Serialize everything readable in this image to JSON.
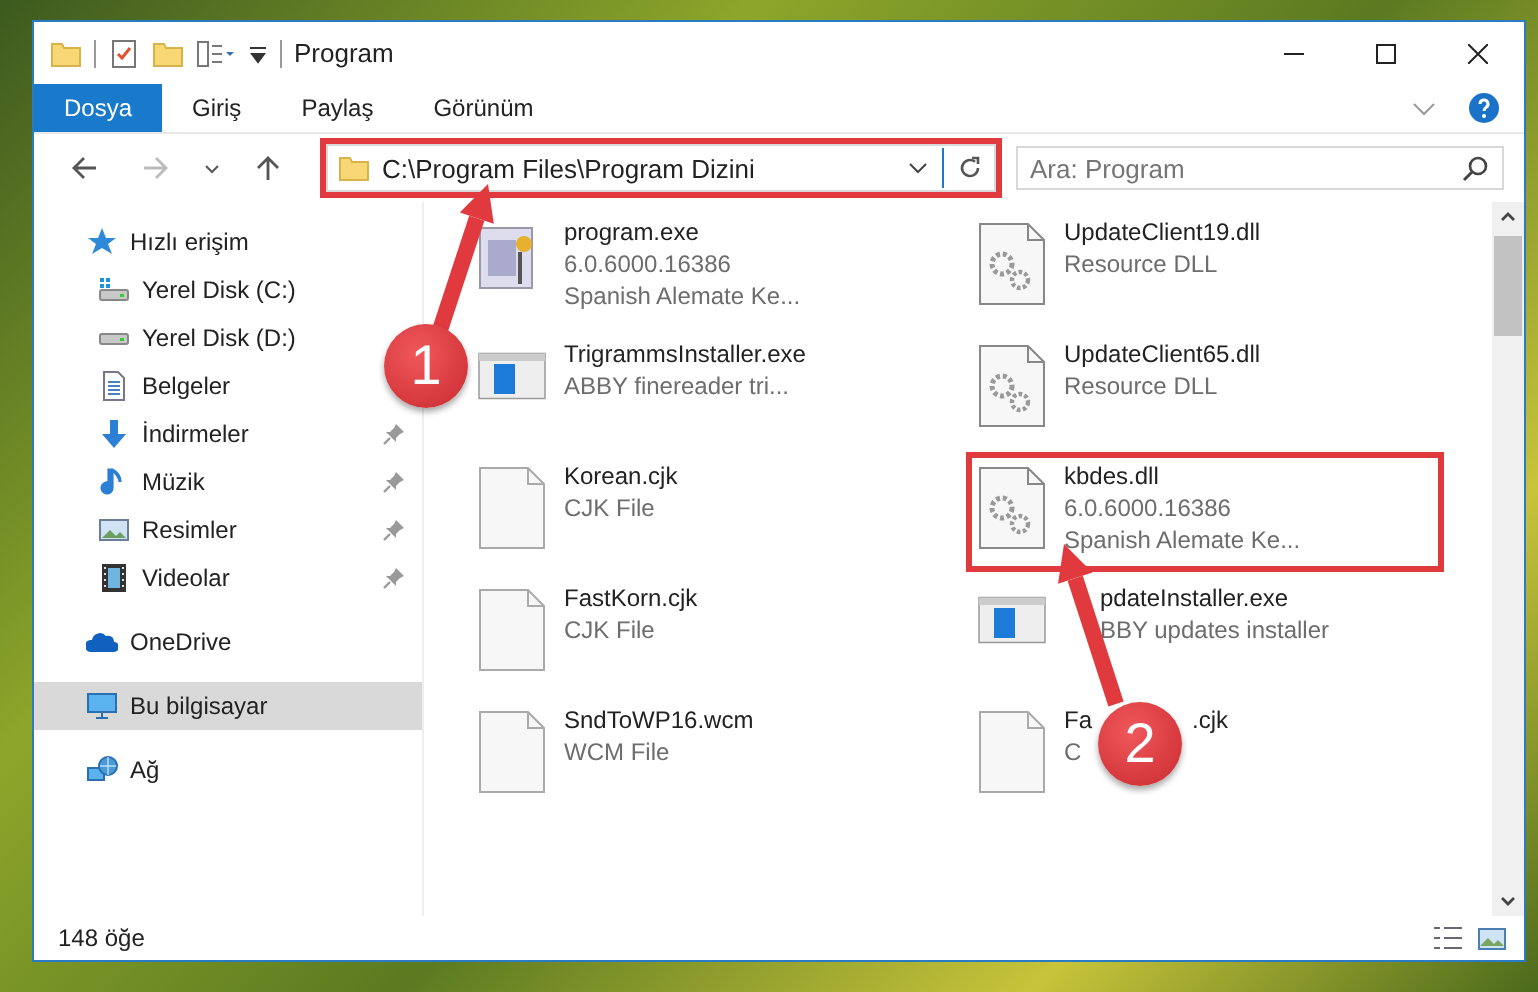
{
  "window": {
    "title": "Program"
  },
  "ribbon_tabs": [
    {
      "label": "Dosya",
      "selected": true
    },
    {
      "label": "Giriş",
      "selected": false
    },
    {
      "label": "Paylaş",
      "selected": false
    },
    {
      "label": "Görünüm",
      "selected": false
    }
  ],
  "address_bar": {
    "path": "C:\\Program Files\\Program Dizini",
    "highlighted": true
  },
  "search": {
    "placeholder": "Ara: Program"
  },
  "sidebar": {
    "items": [
      {
        "label": "Hızlı erişim",
        "kind": "star",
        "selected": false,
        "children": [
          {
            "label": "Yerel Disk (C:)",
            "kind": "system-drive",
            "pinned": false,
            "selected": false
          },
          {
            "label": "Yerel Disk (D:)",
            "kind": "drive",
            "pinned": false,
            "selected": false
          },
          {
            "label": "Belgeler",
            "kind": "documents",
            "pinned": false,
            "selected": false
          },
          {
            "label": "İndirmeler",
            "kind": "downloads",
            "pinned": true,
            "selected": false
          },
          {
            "label": "Müzik",
            "kind": "music",
            "pinned": true,
            "selected": false
          },
          {
            "label": "Resimler",
            "kind": "pictures",
            "pinned": true,
            "selected": false
          },
          {
            "label": "Videolar",
            "kind": "videos",
            "pinned": true,
            "selected": false
          }
        ]
      },
      {
        "label": "OneDrive",
        "kind": "cloud",
        "selected": false
      },
      {
        "label": "Bu bilgisayar",
        "kind": "computer",
        "selected": true
      },
      {
        "label": "Ağ",
        "kind": "network",
        "selected": false
      }
    ]
  },
  "files": [
    {
      "name": "program.exe",
      "details": [
        "6.0.6000.16386",
        "Spanish Alemate Ke..."
      ],
      "kind": "app",
      "highlighted": false
    },
    {
      "name": "UpdateClient19.dll",
      "details": [
        "Resource DLL"
      ],
      "kind": "dll",
      "highlighted": false
    },
    {
      "name": "TrigrammsInstaller.exe",
      "details": [
        "ABBY finereader tri..."
      ],
      "kind": "installer",
      "highlighted": false
    },
    {
      "name": "UpdateClient65.dll",
      "details": [
        "Resource DLL"
      ],
      "kind": "dll",
      "highlighted": false
    },
    {
      "name": "Korean.cjk",
      "details": [
        "CJK File"
      ],
      "kind": "blank",
      "highlighted": false
    },
    {
      "name": "kbdes.dll",
      "details": [
        "6.0.6000.16386",
        "Spanish Alemate Ke..."
      ],
      "kind": "dll",
      "highlighted": true
    },
    {
      "name": "FastKorn.cjk",
      "details": [
        "CJK File"
      ],
      "kind": "blank",
      "highlighted": false
    },
    {
      "name": "pdateInstaller.exe",
      "details": [
        "BBY updates installer"
      ],
      "kind": "installer",
      "highlighted": false,
      "covered_start": true
    },
    {
      "name": "SndToWP16.wcm",
      "details": [
        "WCM File"
      ],
      "kind": "blank",
      "highlighted": false
    },
    {
      "name": "Fa",
      "name_tail": ".cjk",
      "details": [
        "C"
      ],
      "kind": "blank",
      "highlighted": false
    }
  ],
  "status_bar": {
    "count": "148 öğe"
  },
  "callouts": [
    {
      "label": "1"
    },
    {
      "label": "2"
    }
  ]
}
